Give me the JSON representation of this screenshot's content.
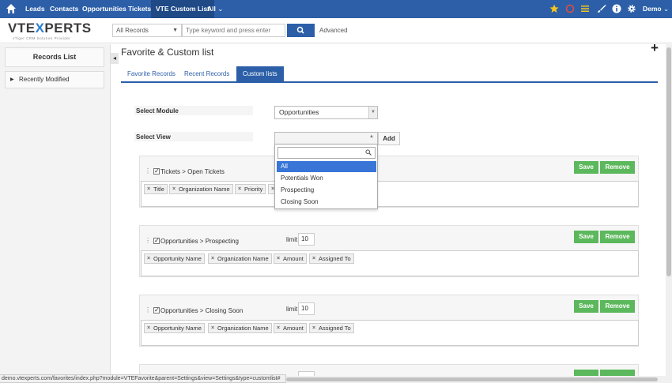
{
  "topnav": {
    "items": [
      "Leads",
      "Contacts",
      "Opportunities",
      "Tickets",
      "VTE Custom List",
      "All"
    ],
    "all_caret": "⌄",
    "user": "Demo",
    "user_caret": "⌄",
    "colors": {
      "bar": "#2c5fa8",
      "active": "#1f4a86"
    }
  },
  "header": {
    "logo_main": "VTE",
    "logo_x": "X",
    "logo_rest": "PERTS",
    "logo_tagline": "vTiger CRM Solution Provider",
    "search_scope": "All Records",
    "search_placeholder": "Type keyword and press enter",
    "advanced_label": "Advanced",
    "plus_label": "+"
  },
  "sidebar": {
    "title": "Records List",
    "items": [
      {
        "label": "Recently Modified",
        "expander": "▶"
      }
    ],
    "collapse_glyph": "◂"
  },
  "main": {
    "page_title": "Favorite & Custom list",
    "tabs": [
      {
        "label": "Favorite Records",
        "active": false
      },
      {
        "label": "Recent Records",
        "active": false
      },
      {
        "label": "Custom lists",
        "active": true
      }
    ],
    "select_module_label": "Select Module",
    "select_module_value": "Opportunities",
    "select_view_label": "Select View",
    "select_view_value": "",
    "add_label": "Add",
    "view_dropdown": {
      "search_value": "",
      "options": [
        "All",
        "Potentials Won",
        "Prospecting",
        "Closing Soon"
      ],
      "selected": "All"
    },
    "panels": [
      {
        "title": "Tickets > Open Tickets",
        "limit_label": "",
        "limit": "",
        "save_label": "Save",
        "remove_label": "Remove",
        "fields": [
          "Title",
          "Organization Name",
          "Priority",
          ""
        ]
      },
      {
        "title": "Opportunities > Prospecting",
        "limit_label": "limit",
        "limit": "10",
        "save_label": "Save",
        "remove_label": "Remove",
        "fields": [
          "Opportunity Name",
          "Organization Name",
          "Amount",
          "Assigned To"
        ]
      },
      {
        "title": "Opportunities > Closing Soon",
        "limit_label": "limit",
        "limit": "10",
        "save_label": "Save",
        "remove_label": "Remove",
        "fields": [
          "Opportunity Name",
          "Organization Name",
          "Amount",
          "Assigned To"
        ]
      }
    ]
  },
  "statusbar": {
    "url": "demo.vtexperts.com/favorites/index.php?module=VTEFavorite&parent=Settings&view=Settings&type=customlist#"
  },
  "colors": {
    "primary": "#2c5fa8",
    "success": "#5cb85c",
    "dropdown_selected": "#3875d7"
  }
}
